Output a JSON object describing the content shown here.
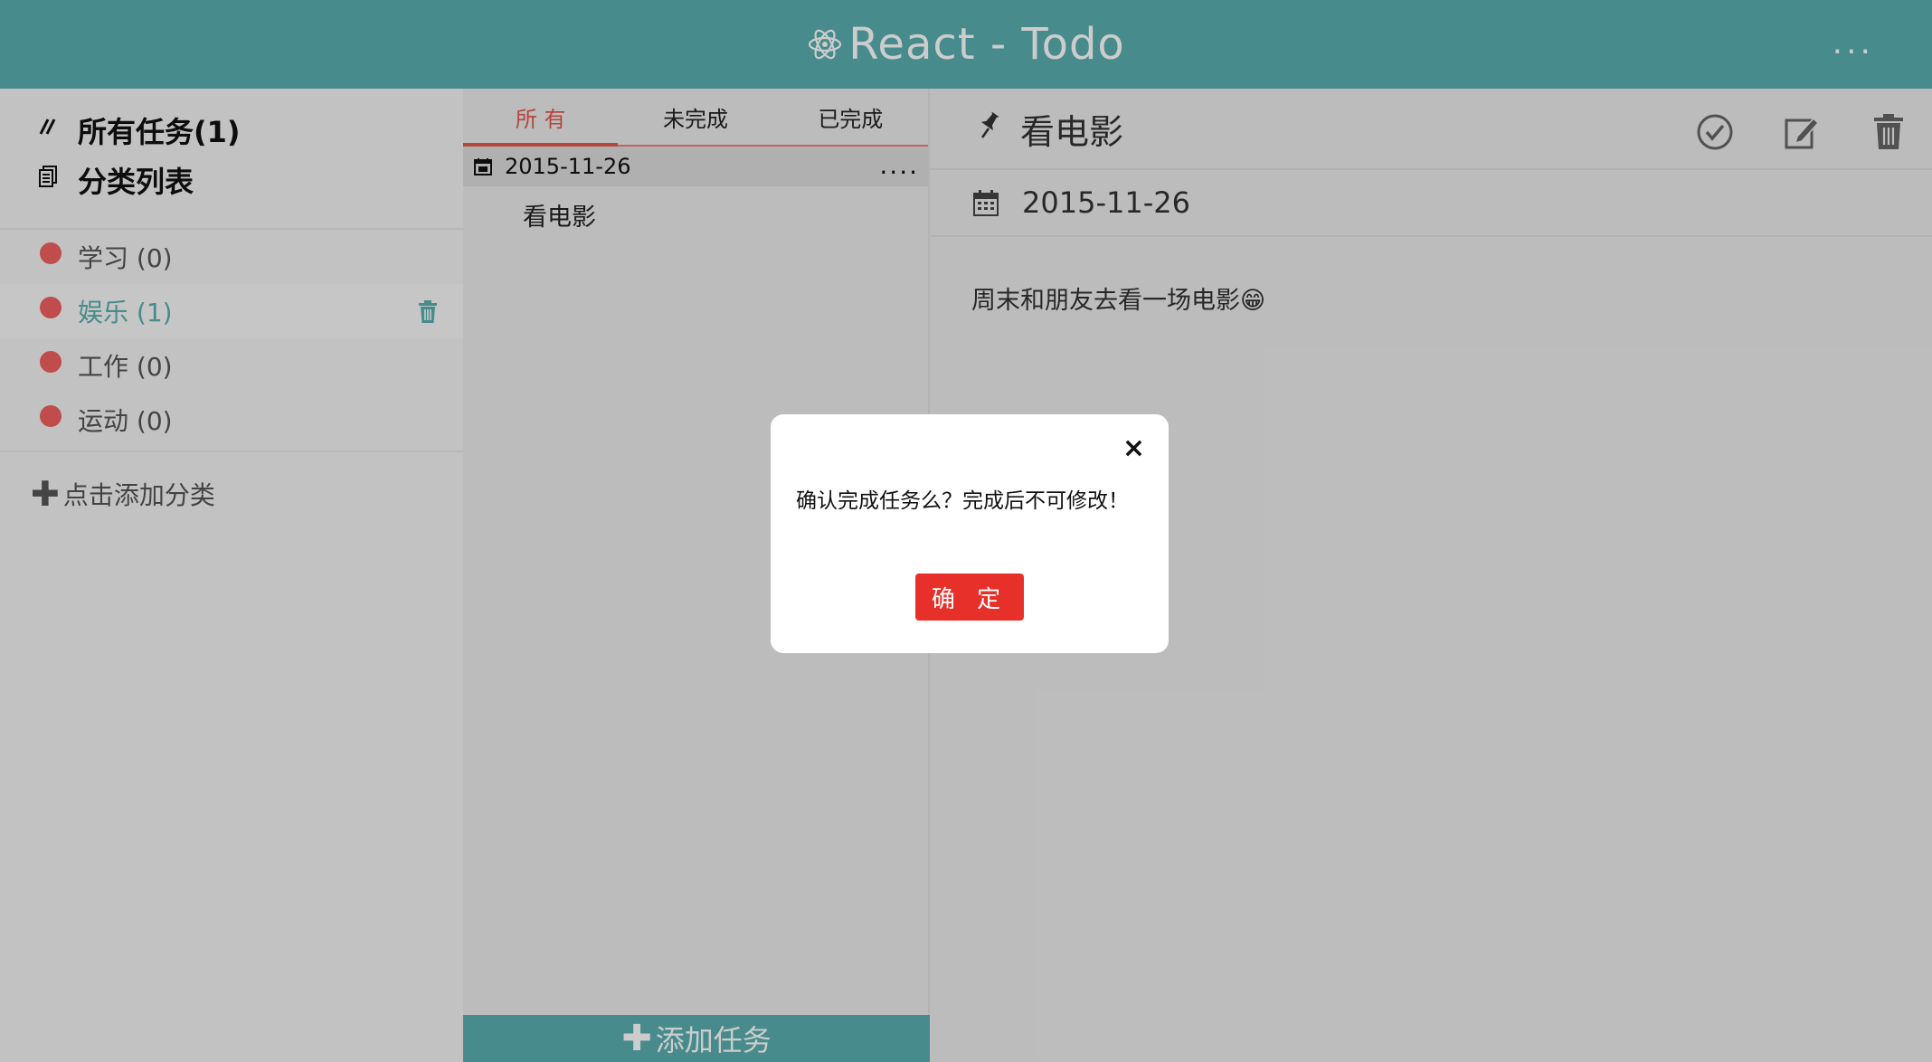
{
  "header": {
    "title": "React - Todo",
    "more_label": "..."
  },
  "sidebar": {
    "all_tasks_label": "所有任务(1)",
    "category_list_label": "分类列表",
    "categories": [
      {
        "label": "学习 (0)"
      },
      {
        "label": "娱乐 (1)"
      },
      {
        "label": "工作 (0)"
      },
      {
        "label": "运动 (0)"
      }
    ],
    "add_category_label": "点击添加分类"
  },
  "tasklist": {
    "tabs": [
      {
        "label": "所 有"
      },
      {
        "label": "未完成"
      },
      {
        "label": "已完成"
      }
    ],
    "date_group": "2015-11-26",
    "more_label": "....",
    "items": [
      {
        "title": "看电影"
      }
    ],
    "add_task_label": "添加任务"
  },
  "detail": {
    "title": "看电影",
    "date": "2015-11-26",
    "content": "周末和朋友去看一场电影😁"
  },
  "modal": {
    "close_label": "×",
    "message": "确认完成任务么？完成后不可修改！",
    "confirm_label": "确 定"
  },
  "colors": {
    "accent": "#59aeb0",
    "category_dot": "#f15f5f",
    "active_tab": "#e0584e",
    "confirm_button": "#e8302a"
  }
}
